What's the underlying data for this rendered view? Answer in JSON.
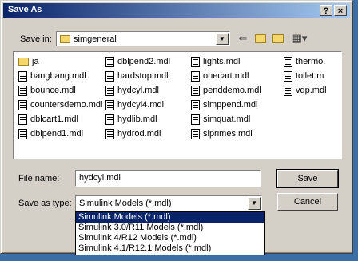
{
  "window": {
    "title": "Save As",
    "help_label": "?",
    "close_label": "×"
  },
  "save_in": {
    "label": "Save in:",
    "value": "simgeneral"
  },
  "toolbar": {
    "icons": [
      "back-arrow-icon",
      "up-folder-icon",
      "new-folder-icon",
      "view-menu-icon"
    ]
  },
  "files": [
    {
      "name": "ja",
      "type": "folder"
    },
    {
      "name": "bangbang.mdl",
      "type": "file"
    },
    {
      "name": "bounce.mdl",
      "type": "file"
    },
    {
      "name": "countersdemo.mdl",
      "type": "file"
    },
    {
      "name": "dblcart1.mdl",
      "type": "file"
    },
    {
      "name": "dblpend1.mdl",
      "type": "file"
    },
    {
      "name": "dblpend2.mdl",
      "type": "file"
    },
    {
      "name": "hardstop.mdl",
      "type": "file"
    },
    {
      "name": "hydcyl.mdl",
      "type": "file"
    },
    {
      "name": "hydcyl4.mdl",
      "type": "file"
    },
    {
      "name": "hydlib.mdl",
      "type": "file"
    },
    {
      "name": "hydrod.mdl",
      "type": "file"
    },
    {
      "name": "lights.mdl",
      "type": "file"
    },
    {
      "name": "onecart.mdl",
      "type": "file"
    },
    {
      "name": "penddemo.mdl",
      "type": "file"
    },
    {
      "name": "simppend.mdl",
      "type": "file"
    },
    {
      "name": "simquat.mdl",
      "type": "file"
    },
    {
      "name": "slprimes.mdl",
      "type": "file"
    },
    {
      "name": "thermo.",
      "type": "file"
    },
    {
      "name": "toilet.m",
      "type": "file"
    },
    {
      "name": "vdp.mdl",
      "type": "file"
    }
  ],
  "file_name": {
    "label": "File name:",
    "value": "hydcyl.mdl"
  },
  "save_as_type": {
    "label": "Save as type:",
    "value": "Simulink Models (*.mdl)",
    "options": [
      "Simulink Models (*.mdl)",
      "Simulink 3.0/R11 Models (*.mdl)",
      "Simulink 4/R12 Models (*.mdl)",
      "Simulink 4.1/R12.1 Models (*.mdl)"
    ],
    "selected_index": 0
  },
  "buttons": {
    "save": "Save",
    "cancel": "Cancel"
  }
}
